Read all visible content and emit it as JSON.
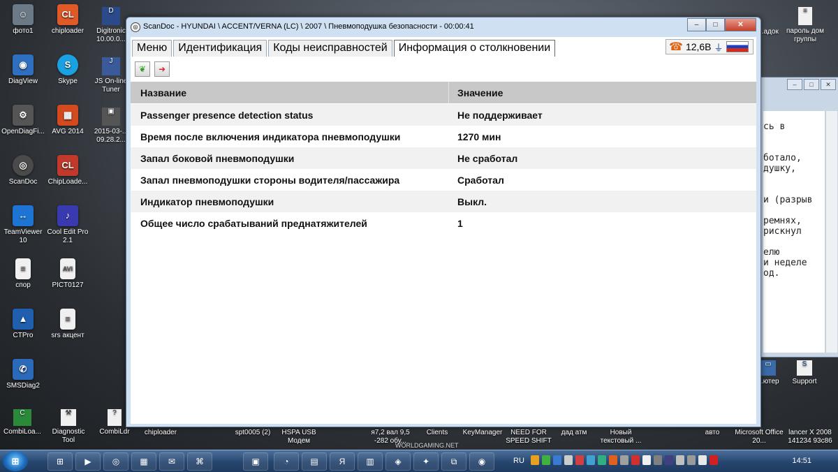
{
  "desktop_icons": [
    {
      "label": "фото1",
      "color": "#6c7a88"
    },
    {
      "label": "chiploader",
      "color": "#e05a28"
    },
    {
      "label": "DiagView",
      "color": "#2f6fbf"
    },
    {
      "label": "Skype",
      "color": "#1aa1e1"
    },
    {
      "label": "OpenDiagFi...",
      "color": "#555555"
    },
    {
      "label": "AVG 2014",
      "color": "#d34a1e"
    },
    {
      "label": "ScanDoc",
      "color": "#4a4a4a"
    },
    {
      "label": "ChipLoade...",
      "color": "#c0392b"
    },
    {
      "label": "TeamViewer 10",
      "color": "#1e74d2"
    },
    {
      "label": "Cool Edit Pro 2.1",
      "color": "#3a3ab0"
    },
    {
      "label": "спор",
      "color": "#f0f0f0"
    },
    {
      "label": "PICT0127",
      "color": "#f0f0f0"
    },
    {
      "label": "CTPro",
      "color": "#1f5fae"
    },
    {
      "label": "srs акцент",
      "color": "#f0f0f0"
    },
    {
      "label": "SMSDiag2",
      "color": "#2a6ab8"
    }
  ],
  "desktop_col3": [
    {
      "label": "Digitronic 10.00.0...",
      "color": "#2a4a8a"
    },
    {
      "label": "JS On-line Tuner",
      "color": "#3a5a9a"
    },
    {
      "label": "2015-03-... 09.28.2...",
      "color": "#555555"
    }
  ],
  "desktop_right": [
    {
      "label": "...адок",
      "color": "#f0f0f0"
    },
    {
      "label": "пароль дом группы",
      "color": "#f0f0f0"
    },
    {
      "label": "...ютер",
      "color": "#3a6aa8"
    },
    {
      "label": "Support",
      "color": "#f0f0f0"
    }
  ],
  "bottom_labels": [
    {
      "label": "CombiLoa...",
      "color": "#2a8a3a"
    },
    {
      "label": "Diagnostic Tool",
      "color": "#f0f0f0"
    },
    {
      "label": "CombiLdr",
      "color": "#f0f0f0"
    },
    {
      "label": "chiploader"
    },
    {
      "label": "spt0005 (2)"
    },
    {
      "label": "HSPA USB Модем"
    },
    {
      "label": "я7,2 вал 9,5 -282 обу..."
    },
    {
      "label": "Clients"
    },
    {
      "label": "KeyManager"
    },
    {
      "label": "NEED FOR SPEED SHIFT"
    },
    {
      "label": "дад атм"
    },
    {
      "label": "Новый текстовый ..."
    },
    {
      "label": "авто"
    },
    {
      "label": "Microsoft Office 20..."
    },
    {
      "label": "lancer X 2008 141234 93c86"
    }
  ],
  "watermark_text": "WORLDGAMING.NET",
  "bg_notepad": {
    "lines": [
      "",
      "сь в",
      "",
      "",
      "ботало,",
      "душку,",
      "",
      "",
      "и (разрыв",
      "",
      "ремнях,",
      "рискнул",
      "",
      "елю",
      "и неделе",
      "од.",
      ""
    ]
  },
  "window": {
    "title": "ScanDoc - HYUNDAI \\ ACCENT/VERNA (LC) \\ 2007 \\ Пневмоподушка безопасности - 00:00:41",
    "tabs": [
      "Меню",
      "Идентификация",
      "Коды неисправностей",
      "Информация о столкновении"
    ],
    "active_tab": 3,
    "voltage": "12,6В",
    "table": {
      "headers": [
        "Название",
        "Значение"
      ],
      "rows": [
        [
          "Passenger presence detection status",
          "Не поддерживает"
        ],
        [
          "Время после включения индикатора пневмоподушки",
          "1270 мин"
        ],
        [
          "Запал боковой пневмоподушки",
          "Не сработал"
        ],
        [
          "Запал пневмоподушки стороны водителя/пассажира",
          "Сработал"
        ],
        [
          "Индикатор пневмоподушки",
          "Выкл."
        ],
        [
          "Общее число срабатываний преднатяжителей",
          "1"
        ]
      ]
    }
  },
  "taskbar": {
    "lang": "RU",
    "clock": "14:51",
    "start_label": "⊞",
    "items": [
      "⊞",
      "▶",
      "◎",
      "▦",
      "✉",
      "⌘",
      "▣",
      "◔",
      "▤",
      "Я",
      "▥",
      "◈",
      "✦",
      "⧉",
      "◉"
    ]
  },
  "colors": {
    "accent_close": "#c4412c",
    "header_bg": "#c8c8c8"
  }
}
